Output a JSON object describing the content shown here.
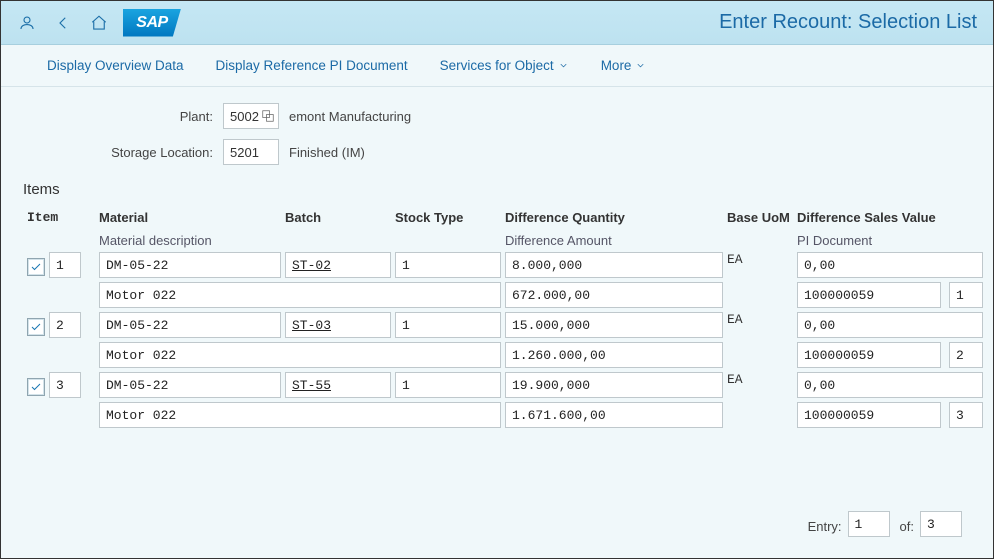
{
  "header": {
    "logo_text": "SAP",
    "page_title": "Enter Recount: Selection List"
  },
  "toolbar": {
    "btn_overview": "Display Overview Data",
    "btn_ref_pi": "Display Reference PI Document",
    "btn_services": "Services for Object",
    "btn_more": "More"
  },
  "form": {
    "plant_label": "Plant:",
    "plant_value": "5002",
    "plant_desc": "emont Manufacturing",
    "sloc_label": "Storage Location:",
    "sloc_value": "5201",
    "sloc_desc": "Finished (IM)"
  },
  "section_title": "Items",
  "col_headers": {
    "item": "Item",
    "material": "Material",
    "batch": "Batch",
    "stock_type": "Stock Type",
    "diff_qty": "Difference Quantity",
    "base_uom": "Base UoM",
    "diff_val": "Difference Sales Value",
    "mat_desc": "Material description",
    "diff_amt": "Difference Amount",
    "pi_doc": "PI Document"
  },
  "rows": [
    {
      "checked": true,
      "item": "1",
      "material": "DM-05-22",
      "batch": "ST-02",
      "stock_type": "1",
      "diff_qty": "8.000,000",
      "uom": "EA",
      "diff_val": "0,00",
      "mat_desc": "Motor 022",
      "diff_amt": "672.000,00",
      "pi_doc": "100000059",
      "pi_item": "1"
    },
    {
      "checked": true,
      "item": "2",
      "material": "DM-05-22",
      "batch": "ST-03",
      "stock_type": "1",
      "diff_qty": "15.000,000",
      "uom": "EA",
      "diff_val": "0,00",
      "mat_desc": "Motor 022",
      "diff_amt": "1.260.000,00",
      "pi_doc": "100000059",
      "pi_item": "2"
    },
    {
      "checked": true,
      "item": "3",
      "material": "DM-05-22",
      "batch": "ST-55",
      "stock_type": "1",
      "diff_qty": "19.900,000",
      "uom": "EA",
      "diff_val": "0,00",
      "mat_desc": "Motor 022",
      "diff_amt": "1.671.600,00",
      "pi_doc": "100000059",
      "pi_item": "3"
    }
  ],
  "footer": {
    "entry_lbl": "Entry:",
    "entry_val": "1",
    "of_lbl": "of:",
    "of_val": "3"
  }
}
